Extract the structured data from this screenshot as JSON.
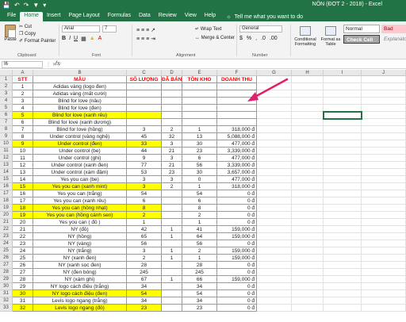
{
  "window": {
    "title": "NÔN (ĐỢT 2 - 2018) - Excel",
    "qat_icons": [
      "save-icon",
      "undo-icon",
      "redo-icon",
      "filter-icon",
      "customize-icon"
    ]
  },
  "ribbon": {
    "tabs": [
      "File",
      "Home",
      "Insert",
      "Page Layout",
      "Formulas",
      "Data",
      "Review",
      "View",
      "Help"
    ],
    "active_tab": "Home",
    "tell_me": "Tell me what you want to do",
    "clipboard": {
      "paste": "Paste",
      "cut": "Cut",
      "copy": "Copy",
      "format_painter": "Format Painter",
      "label": "Clipboard"
    },
    "font": {
      "name": "Arial",
      "size": "7",
      "label": "Font",
      "bold": "B",
      "italic": "I",
      "underline": "U"
    },
    "alignment": {
      "wrap_text": "Wrap Text",
      "merge_center": "Merge & Center",
      "label": "Alignment"
    },
    "number": {
      "format": "General",
      "percent": "%",
      "comma": ",",
      "label": "Number"
    },
    "styles": {
      "conditional_formatting": "Conditional Formatting",
      "format_as_table": "Format as Table",
      "normal": "Normal",
      "bad": "Bad",
      "check_cell": "Check Cell",
      "explanatory": "Explanatory"
    }
  },
  "formula_bar": {
    "name_box": "I6",
    "fx": "fx",
    "value": ""
  },
  "sheet": {
    "columns": [
      "A",
      "B",
      "C",
      "D",
      "E",
      "F",
      "G",
      "H",
      "I",
      "J"
    ],
    "header": {
      "stt": "STT",
      "mau": "MẪU",
      "so_luong": "SỐ LƯỢNG",
      "da_ban": "ĐÃ BÁN",
      "ton_kho": "TỒN KHO",
      "doanh_thu": "DOANH THU"
    },
    "rows": [
      {
        "n": "2",
        "stt": "1",
        "mau": "Adidas vàng (logo đen)",
        "sl": "",
        "db": "",
        "tk": "",
        "dt": "",
        "hl": false
      },
      {
        "n": "3",
        "stt": "2",
        "mau": "Adidas vàng (mất cười)",
        "sl": "",
        "db": "",
        "tk": "",
        "dt": "",
        "hl": false
      },
      {
        "n": "4",
        "stt": "3",
        "mau": "Blind for love (nâu)",
        "sl": "",
        "db": "",
        "tk": "",
        "dt": "",
        "hl": false
      },
      {
        "n": "5",
        "stt": "4",
        "mau": "Blind for love (đen)",
        "sl": "",
        "db": "",
        "tk": "",
        "dt": "",
        "hl": false
      },
      {
        "n": "6",
        "stt": "5",
        "mau": "Blind for love (xanh rêu)",
        "sl": "",
        "db": "",
        "tk": "",
        "dt": "",
        "hl": true
      },
      {
        "n": "7",
        "stt": "6",
        "mau": "Blind for love (xanh dương)",
        "sl": "",
        "db": "",
        "tk": "",
        "dt": "",
        "hl": false
      },
      {
        "n": "8",
        "stt": "7",
        "mau": "Blind for love (hồng)",
        "sl": "3",
        "db": "2",
        "tk": "1",
        "dt": "318,000 đ",
        "hl": false
      },
      {
        "n": "9",
        "stt": "8",
        "mau": "Under control (vàng nghệ)",
        "sl": "45",
        "db": "32",
        "tk": "13",
        "dt": "5,088,000 đ",
        "hl": false
      },
      {
        "n": "10",
        "stt": "9",
        "mau": "Under control (đen)",
        "sl": "33",
        "db": "3",
        "tk": "30",
        "dt": "477,000 đ",
        "hl": true
      },
      {
        "n": "11",
        "stt": "10",
        "mau": "Under control (be)",
        "sl": "44",
        "db": "21",
        "tk": "23",
        "dt": "3,339,000 đ",
        "hl": false
      },
      {
        "n": "12",
        "stt": "11",
        "mau": "Under control (ghi)",
        "sl": "9",
        "db": "3",
        "tk": "6",
        "dt": "477,000 đ",
        "hl": false
      },
      {
        "n": "13",
        "stt": "12",
        "mau": "Under control (xanh đen)",
        "sl": "77",
        "db": "21",
        "tk": "56",
        "dt": "3,339,000 đ",
        "hl": false
      },
      {
        "n": "14",
        "stt": "13",
        "mau": "Under control (xám đậm)",
        "sl": "53",
        "db": "23",
        "tk": "30",
        "dt": "3,657,000 đ",
        "hl": false
      },
      {
        "n": "15",
        "stt": "14",
        "mau": "Yes you can (be)",
        "sl": "3",
        "db": "3",
        "tk": "0",
        "dt": "477,000 đ",
        "hl": false
      },
      {
        "n": "16",
        "stt": "15",
        "mau": "Yes you can (xanh mint)",
        "sl": "3",
        "db": "2",
        "tk": "1",
        "dt": "318,000 đ",
        "hl": true
      },
      {
        "n": "17",
        "stt": "16",
        "mau": "Yes you can (trắng)",
        "sl": "54",
        "db": "",
        "tk": "54",
        "dt": "0 đ",
        "hl": false
      },
      {
        "n": "18",
        "stt": "17",
        "mau": "Yes you can (xanh rêu)",
        "sl": "6",
        "db": "",
        "tk": "6",
        "dt": "0 đ",
        "hl": false
      },
      {
        "n": "19",
        "stt": "18",
        "mau": "Yes you can (hồng nhạt)",
        "sl": "8",
        "db": "",
        "tk": "8",
        "dt": "0 đ",
        "hl": true
      },
      {
        "n": "20",
        "stt": "19",
        "mau": "Yes you can (hồng cánh sen)",
        "sl": "2",
        "db": "",
        "tk": "2",
        "dt": "0 đ",
        "hl": true
      },
      {
        "n": "21",
        "stt": "20",
        "mau": "Yes you can ( đỏ )",
        "sl": "1",
        "db": "",
        "tk": "1",
        "dt": "0 đ",
        "hl": false
      },
      {
        "n": "22",
        "stt": "21",
        "mau": "NY (đỏ)",
        "sl": "42",
        "db": "1",
        "tk": "41",
        "dt": "159,000 đ",
        "hl": false
      },
      {
        "n": "23",
        "stt": "22",
        "mau": "NY (hồng)",
        "sl": "65",
        "db": "1",
        "tk": "64",
        "dt": "159,000 đ",
        "hl": false
      },
      {
        "n": "24",
        "stt": "23",
        "mau": "NY (vàng)",
        "sl": "56",
        "db": "",
        "tk": "56",
        "dt": "0 đ",
        "hl": false
      },
      {
        "n": "25",
        "stt": "24",
        "mau": "NY (trắng)",
        "sl": "3",
        "db": "1",
        "tk": "2",
        "dt": "159,000 đ",
        "hl": false
      },
      {
        "n": "26",
        "stt": "25",
        "mau": "NY (xanh đen)",
        "sl": "2",
        "db": "1",
        "tk": "1",
        "dt": "159,000 đ",
        "hl": false
      },
      {
        "n": "27",
        "stt": "26",
        "mau": "NY (xanh sọc đen)",
        "sl": "28",
        "db": "",
        "tk": "28",
        "dt": "0 đ",
        "hl": false
      },
      {
        "n": "28",
        "stt": "27",
        "mau": "NY (đen bóng)",
        "sl": "245",
        "db": "",
        "tk": "245",
        "dt": "0 đ",
        "hl": false
      },
      {
        "n": "29",
        "stt": "28",
        "mau": "NY (xám ghi)",
        "sl": "67",
        "db": "1",
        "tk": "66",
        "dt": "159,000 đ",
        "hl": false
      },
      {
        "n": "30",
        "stt": "29",
        "mau": "NY logo cách điệu (trắng)",
        "sl": "34",
        "db": "",
        "tk": "34",
        "dt": "0 đ",
        "hl": false
      },
      {
        "n": "31",
        "stt": "30",
        "mau": "NY logo cách điệu (đen)",
        "sl": "54",
        "db": "",
        "tk": "54",
        "dt": "0 đ",
        "hl": true
      },
      {
        "n": "32",
        "stt": "31",
        "mau": "Levis logo ngang (trắng)",
        "sl": "34",
        "db": "",
        "tk": "34",
        "dt": "0 đ",
        "hl": false
      },
      {
        "n": "33",
        "stt": "32",
        "mau": "Levis logo ngang (đỏ)",
        "sl": "23",
        "db": "",
        "tk": "23",
        "dt": "0 đ",
        "hl": true
      }
    ]
  },
  "colors": {
    "excel_green": "#217346",
    "highlight": "#ffff00",
    "header_red": "#ff0000",
    "arrow": "#e0206a"
  }
}
